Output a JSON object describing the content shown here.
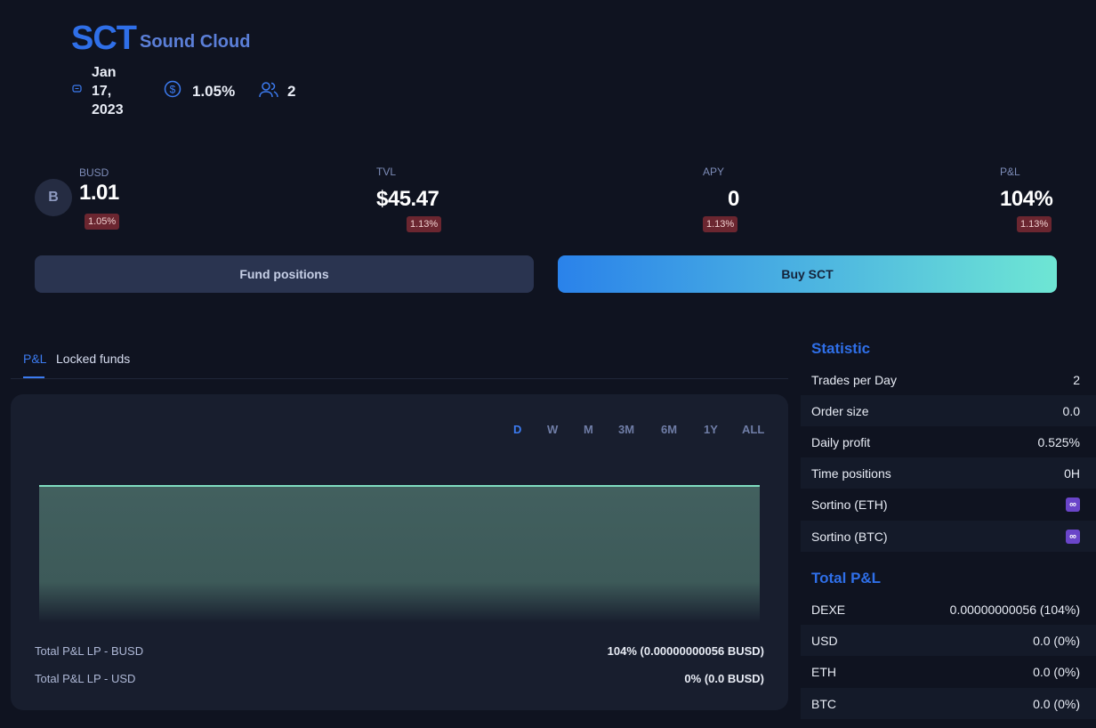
{
  "header": {
    "ticker": "SCT",
    "name": "Sound Cloud",
    "date": "Jan 17, 2023",
    "rate": "1.05%",
    "investors": "2"
  },
  "stats": {
    "base": {
      "label": "BUSD",
      "avatar_letter": "B",
      "value": "1.01",
      "change": "1.05%"
    },
    "tvl": {
      "label": "TVL",
      "value": "$45.47",
      "change": "1.13%"
    },
    "apy": {
      "label": "APY",
      "value": "0",
      "change": "1.13%"
    },
    "pnl": {
      "label": "P&L",
      "value": "104%",
      "change": "1.13%"
    }
  },
  "actions": {
    "fund": "Fund positions",
    "buy": "Buy SCT"
  },
  "tabs": [
    {
      "label": "P&L",
      "active": true
    },
    {
      "label": "Locked funds",
      "active": false
    }
  ],
  "periods": [
    "D",
    "W",
    "M",
    "3M",
    "6M",
    "1Y",
    "ALL"
  ],
  "active_period": "D",
  "chart_data": {
    "type": "area",
    "series": [
      {
        "values": [
          104,
          104
        ]
      }
    ],
    "grid": false,
    "colors": {
      "line": "#7fdcc0",
      "fill": "#3f5d5c"
    }
  },
  "lp": [
    {
      "label": "Total P&L LP - BUSD",
      "value": "104% (0.00000000056 BUSD)"
    },
    {
      "label": "Total P&L LP - USD",
      "value": "0% (0.0 BUSD)"
    }
  ],
  "statistic": {
    "title": "Statistic",
    "rows": [
      {
        "label": "Trades per Day",
        "value": "2"
      },
      {
        "label": "Order size",
        "value": "0.0"
      },
      {
        "label": "Daily profit",
        "value": "0.525%"
      },
      {
        "label": "Time positions",
        "value": "0H"
      },
      {
        "label": "Sortino (ETH)",
        "value": "∞"
      },
      {
        "label": "Sortino (BTC)",
        "value": "∞"
      }
    ]
  },
  "total_pnl": {
    "title": "Total P&L",
    "rows": [
      {
        "label": "DEXE",
        "value": "0.00000000056 (104%)"
      },
      {
        "label": "USD",
        "value": "0.0 (0%)"
      },
      {
        "label": "ETH",
        "value": "0.0 (0%)"
      },
      {
        "label": "BTC",
        "value": "0.0 (0%)"
      }
    ]
  }
}
